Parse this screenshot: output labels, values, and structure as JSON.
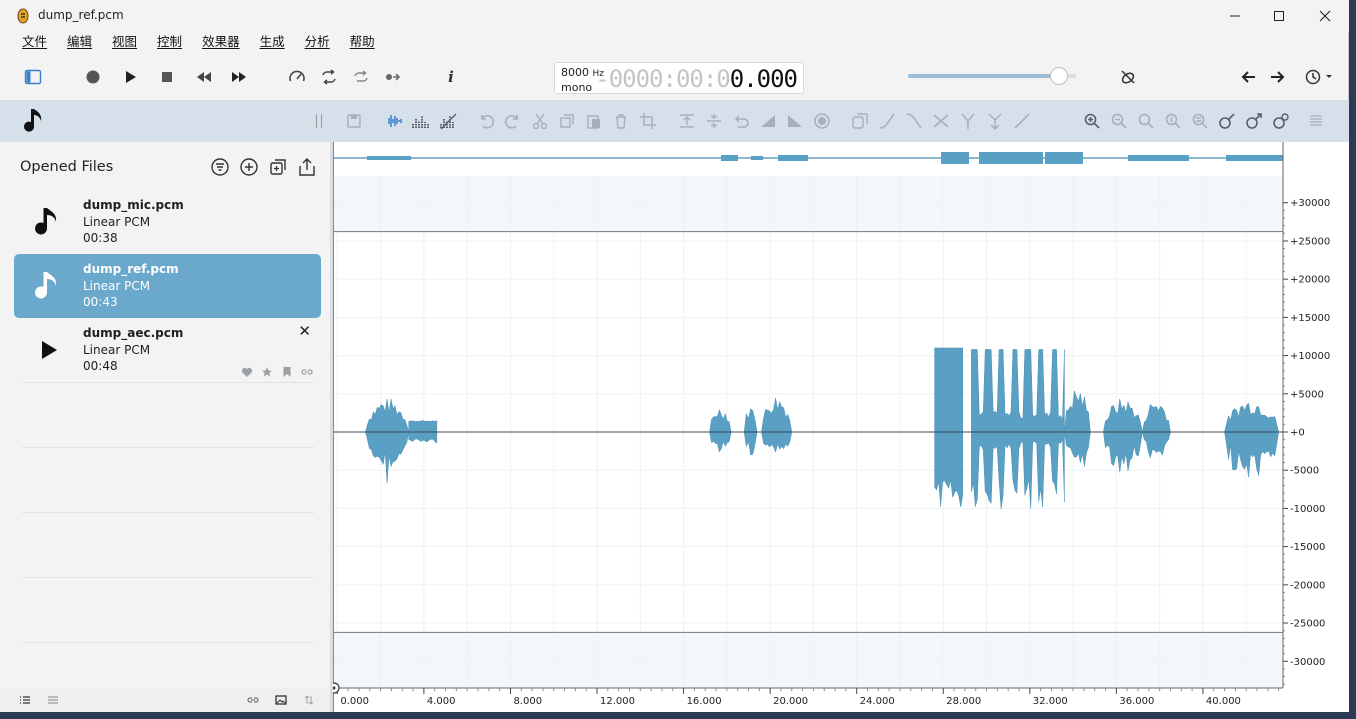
{
  "window": {
    "title": "dump_ref.pcm"
  },
  "menu": [
    "文件",
    "编辑",
    "视图",
    "控制",
    "效果器",
    "生成",
    "分析",
    "帮助"
  ],
  "transport": {
    "sample_rate": "8000",
    "sample_rate_unit": "Hz",
    "channels": "mono",
    "time_dim": "-0000:00:0",
    "time_bright": "0.000",
    "volume_level": 0.9
  },
  "sidebar": {
    "title": "Opened Files",
    "files": [
      {
        "name": "dump_mic.pcm",
        "format": "Linear PCM",
        "duration": "00:38",
        "selected": false,
        "icon": "music-note-icon"
      },
      {
        "name": "dump_ref.pcm",
        "format": "Linear PCM",
        "duration": "00:43",
        "selected": true,
        "icon": "music-note-icon"
      },
      {
        "name": "dump_aec.pcm",
        "format": "Linear PCM",
        "duration": "00:48",
        "selected": false,
        "icon": "play-icon"
      }
    ]
  },
  "waveform": {
    "y_ticks": [
      "+30000",
      "+25000",
      "+20000",
      "+15000",
      "+10000",
      "+5000",
      "+0",
      "-5000",
      "-10000",
      "-15000",
      "-20000",
      "-25000",
      "-30000"
    ],
    "x_ticks": [
      "0.000",
      "4.000",
      "8.000",
      "12.000",
      "16.000",
      "20.000",
      "24.000",
      "28.000",
      "32.000",
      "36.000",
      "40.000"
    ],
    "color": "#5a9fc4"
  }
}
